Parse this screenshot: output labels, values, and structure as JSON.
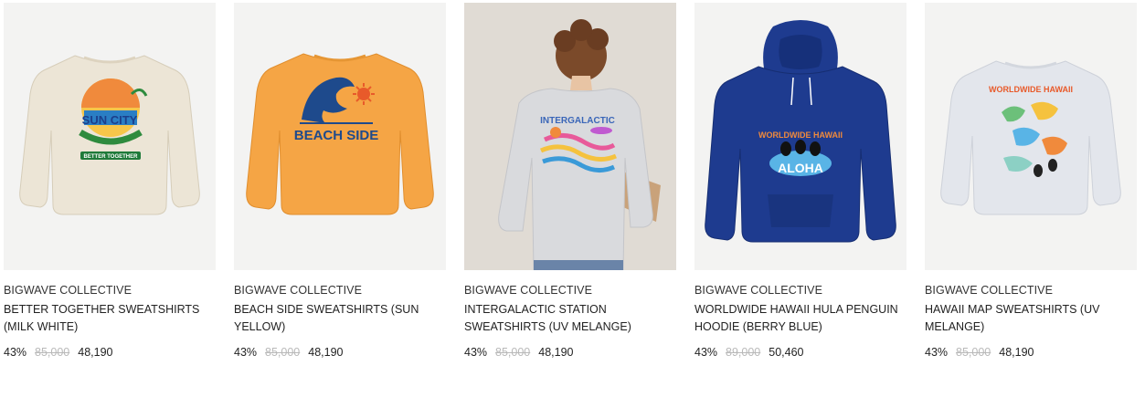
{
  "products": [
    {
      "brand": "BIGWAVE COLLECTIVE",
      "name": "BETTER TOGETHER SWEATSHIRTS (MILK WHITE)",
      "discount": "43%",
      "original_price": "85,000",
      "sale_price": "48,190",
      "image": {
        "kind": "sweatshirt",
        "garment_color": "#ece5d6",
        "print_text_1": "SUN CITY",
        "print_text_2": "BETTER TOGETHER"
      }
    },
    {
      "brand": "BIGWAVE COLLECTIVE",
      "name": "BEACH SIDE SWEATSHIRTS (SUN YELLOW)",
      "discount": "43%",
      "original_price": "85,000",
      "sale_price": "48,190",
      "image": {
        "kind": "sweatshirt",
        "garment_color": "#f5a545",
        "print_text_1": "BEACH SIDE"
      }
    },
    {
      "brand": "BIGWAVE COLLECTIVE",
      "name": "INTERGALACTIC STATION SWEATSHIRTS (UV MELANGE)",
      "discount": "43%",
      "original_price": "85,000",
      "sale_price": "48,190",
      "image": {
        "kind": "model",
        "garment_color": "#d9dadd",
        "print_text_1": "INTERGALACTIC"
      }
    },
    {
      "brand": "BIGWAVE COLLECTIVE",
      "name": "WORLDWIDE HAWAII HULA PENGUIN HOODIE (BERRY BLUE)",
      "discount": "43%",
      "original_price": "89,000",
      "sale_price": "50,460",
      "image": {
        "kind": "hoodie",
        "garment_color": "#1e3b8f",
        "print_text_1": "WORLDWIDE HAWAII",
        "print_text_2": "ALOHA"
      }
    },
    {
      "brand": "BIGWAVE COLLECTIVE",
      "name": "HAWAII MAP SWEATSHIRTS (UV MELANGE)",
      "discount": "43%",
      "original_price": "85,000",
      "sale_price": "48,190",
      "image": {
        "kind": "sweatshirt",
        "garment_color": "#e3e6ec",
        "print_text_1": "WORLDWIDE HAWAII"
      }
    }
  ]
}
